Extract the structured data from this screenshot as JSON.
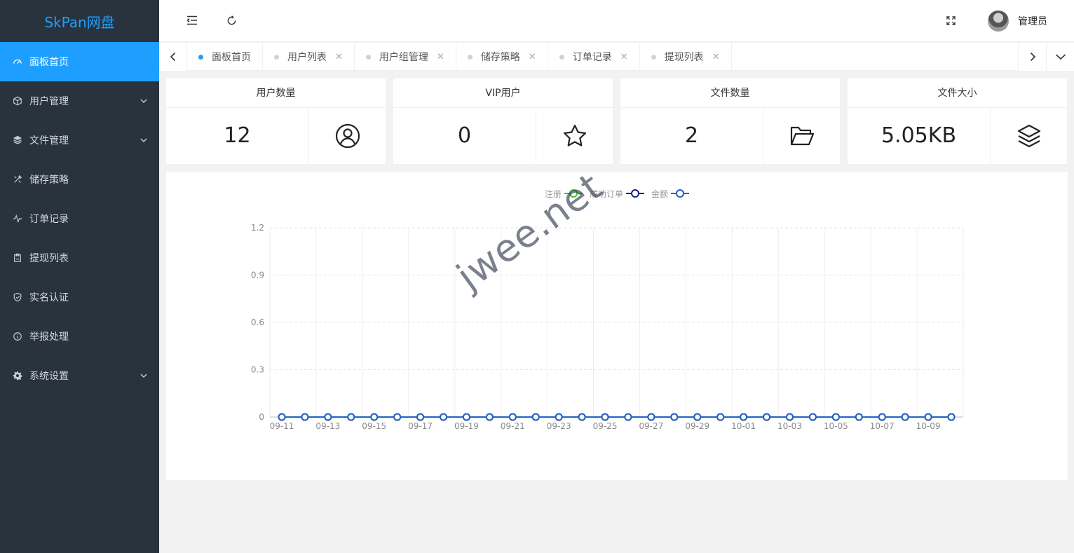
{
  "app": {
    "logo": "SkPan网盘"
  },
  "sidebar": {
    "items": [
      {
        "label": "面板首页",
        "icon": "dashboard-icon",
        "active": true,
        "expandable": false
      },
      {
        "label": "用户管理",
        "icon": "cube-icon",
        "active": false,
        "expandable": true
      },
      {
        "label": "文件管理",
        "icon": "layers-icon",
        "active": false,
        "expandable": true
      },
      {
        "label": "储存策略",
        "icon": "tools-icon",
        "active": false,
        "expandable": false
      },
      {
        "label": "订单记录",
        "icon": "activity-icon",
        "active": false,
        "expandable": false
      },
      {
        "label": "提现列表",
        "icon": "clipboard-icon",
        "active": false,
        "expandable": false
      },
      {
        "label": "实名认证",
        "icon": "shield-check-icon",
        "active": false,
        "expandable": false
      },
      {
        "label": "举报处理",
        "icon": "info-icon",
        "active": false,
        "expandable": false
      },
      {
        "label": "系统设置",
        "icon": "gear-icon",
        "active": false,
        "expandable": true
      }
    ]
  },
  "topbar": {
    "user_name": "管理员"
  },
  "tabs": [
    {
      "label": "面板首页",
      "active": true,
      "closable": false
    },
    {
      "label": "用户列表",
      "active": false,
      "closable": true
    },
    {
      "label": "用户组管理",
      "active": false,
      "closable": true
    },
    {
      "label": "储存策略",
      "active": false,
      "closable": true
    },
    {
      "label": "订单记录",
      "active": false,
      "closable": true
    },
    {
      "label": "提现列表",
      "active": false,
      "closable": true
    }
  ],
  "stats": [
    {
      "title": "用户数量",
      "value": "12",
      "icon": "user-circle-icon"
    },
    {
      "title": "VIP用户",
      "value": "0",
      "icon": "star-icon"
    },
    {
      "title": "文件数量",
      "value": "2",
      "icon": "folder-open-icon"
    },
    {
      "title": "文件大小",
      "value": "5.05KB",
      "icon": "layers-icon"
    }
  ],
  "watermark": "jwee.net",
  "colors": {
    "accent": "#1e9fff",
    "sidebar_bg": "#28333e"
  },
  "chart_data": {
    "type": "line",
    "x": [
      "09-11",
      "09-12",
      "09-13",
      "09-14",
      "09-15",
      "09-16",
      "09-17",
      "09-18",
      "09-19",
      "09-20",
      "09-21",
      "09-22",
      "09-23",
      "09-24",
      "09-25",
      "09-26",
      "09-27",
      "09-28",
      "09-29",
      "09-30",
      "10-01",
      "10-02",
      "10-03",
      "10-04",
      "10-05",
      "10-06",
      "10-07",
      "10-08",
      "10-09",
      "10-10"
    ],
    "x_tick_labels": [
      "09-11",
      "09-13",
      "09-15",
      "09-17",
      "09-19",
      "09-21",
      "09-23",
      "09-25",
      "09-27",
      "09-29",
      "10-01",
      "10-03",
      "10-05",
      "10-07",
      "10-09"
    ],
    "y_ticks": [
      "0",
      "0.3",
      "0.6",
      "0.9",
      "1.2"
    ],
    "ylim": [
      0,
      1.2
    ],
    "series": [
      {
        "name": "注册",
        "color": "#2ec72e",
        "values": [
          0,
          0,
          0,
          0,
          0,
          0,
          0,
          0,
          0,
          0,
          0,
          0,
          0,
          0,
          0,
          0,
          0,
          0,
          0,
          0,
          0,
          0,
          0,
          0,
          0,
          0,
          0,
          0,
          0,
          0
        ]
      },
      {
        "name": "成功订单",
        "color": "#1a1f8c",
        "values": [
          0,
          0,
          0,
          0,
          0,
          0,
          0,
          0,
          0,
          0,
          0,
          0,
          0,
          0,
          0,
          0,
          0,
          0,
          0,
          0,
          0,
          0,
          0,
          0,
          0,
          0,
          0,
          0,
          0,
          0
        ]
      },
      {
        "name": "金额",
        "color": "#1f62c4",
        "values": [
          0,
          0,
          0,
          0,
          0,
          0,
          0,
          0,
          0,
          0,
          0,
          0,
          0,
          0,
          0,
          0,
          0,
          0,
          0,
          0,
          0,
          0,
          0,
          0,
          0,
          0,
          0,
          0,
          0,
          0
        ]
      }
    ],
    "grid": true,
    "legend": "top-center"
  }
}
